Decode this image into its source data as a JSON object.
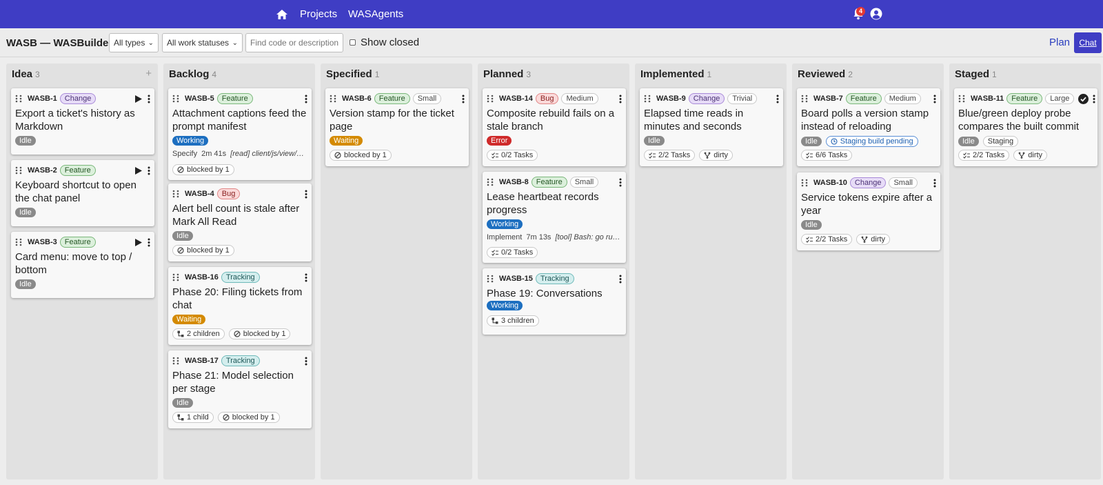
{
  "nav": {
    "projects": "Projects",
    "wasagents": "WASAgents",
    "notifications": "4",
    "home_icon": "home-icon",
    "account_icon": "account-icon"
  },
  "toolbar": {
    "title": "WASB — WASBuilder",
    "type_filter": "All types",
    "status_filter": "All work statuses",
    "search_placeholder": "Find code or description",
    "show_closed": "Show closed",
    "plan": "Plan",
    "chat": "Chat"
  },
  "columns": [
    {
      "name": "Idea",
      "count": "3",
      "cards": [
        {
          "code": "WASB-1",
          "type": "Change",
          "title": "Export a ticket's history as Markdown",
          "status": "Idle"
        },
        {
          "code": "WASB-2",
          "type": "Feature",
          "title": "Keyboard shortcut to open the chat panel",
          "status": "Idle"
        },
        {
          "code": "WASB-3",
          "type": "Feature",
          "title": "Card menu: move to top / bottom",
          "status": "Idle"
        }
      ]
    },
    {
      "name": "Backlog",
      "count": "4",
      "cards": [
        {
          "code": "WASB-5",
          "type": "Feature",
          "title": "Attachment captions feed the prompt manifest",
          "status": "Working",
          "activity": "Specify",
          "elapsed": "2m 41s",
          "tool": "[read] client/js/view/view-ticket.js",
          "chips": [
            "blocked by 1"
          ]
        },
        {
          "code": "WASB-4",
          "type": "Bug",
          "title": "Alert bell count is stale after Mark All Read",
          "status": "Idle",
          "chips": [
            "blocked by 1"
          ]
        },
        {
          "code": "WASB-16",
          "type": "Tracking",
          "title": "Phase 20: Filing tickets from chat",
          "status": "Waiting",
          "chips": [
            "2 children",
            "blocked by 1"
          ]
        },
        {
          "code": "WASB-17",
          "type": "Tracking",
          "title": "Phase 21: Model selection per stage",
          "status": "Idle",
          "chips": [
            "1 child",
            "blocked by 1"
          ]
        }
      ]
    },
    {
      "name": "Specified",
      "count": "1",
      "cards": [
        {
          "code": "WASB-6",
          "type": "Feature",
          "size": "Small",
          "title": "Version stamp for the ticket page",
          "status": "Waiting",
          "chips": [
            "blocked by 1"
          ]
        }
      ]
    },
    {
      "name": "Planned",
      "count": "3",
      "cards": [
        {
          "code": "WASB-14",
          "type": "Bug",
          "size": "Medium",
          "title": "Composite rebuild fails on a stale branch",
          "status": "Error",
          "chips": [
            "0/2 Tasks"
          ]
        },
        {
          "code": "WASB-8",
          "type": "Feature",
          "size": "Small",
          "title": "Lease heartbeat records progress",
          "status": "Working",
          "activity": "Implement",
          "elapsed": "7m 13s",
          "tool": "[tool] Bash: go run ./cmd/build",
          "chips": [
            "0/2 Tasks"
          ]
        },
        {
          "code": "WASB-15",
          "type": "Tracking",
          "title": "Phase 19: Conversations",
          "status": "Working",
          "chips": [
            "3 children"
          ]
        }
      ]
    },
    {
      "name": "Implemented",
      "count": "1",
      "cards": [
        {
          "code": "WASB-9",
          "type": "Change",
          "size": "Trivial",
          "title": "Elapsed time reads in minutes and seconds",
          "status": "Idle",
          "chips": [
            "2/2 Tasks",
            "dirty"
          ]
        }
      ]
    },
    {
      "name": "Reviewed",
      "count": "2",
      "cards": [
        {
          "code": "WASB-7",
          "type": "Feature",
          "size": "Medium",
          "title": "Board polls a version stamp instead of reloading",
          "status": "Idle",
          "pending": "Staging build pending",
          "chips": [
            "6/6 Tasks"
          ]
        },
        {
          "code": "WASB-10",
          "type": "Change",
          "size": "Small",
          "title": "Service tokens expire after a year",
          "status": "Idle",
          "chips": [
            "2/2 Tasks",
            "dirty"
          ]
        }
      ]
    },
    {
      "name": "Staged",
      "count": "1",
      "cards": [
        {
          "code": "WASB-11",
          "type": "Feature",
          "size": "Large",
          "title": "Blue/green deploy probe compares the built commit",
          "status": "Idle",
          "stage": "Staging",
          "chips": [
            "2/2 Tasks",
            "dirty"
          ]
        }
      ]
    }
  ],
  "colors": {
    "nav": "#3f3dc4",
    "working": "#1d6fc0",
    "waiting": "#d48a00",
    "error": "#cf2a2a",
    "idle": "#8a8a8a"
  }
}
